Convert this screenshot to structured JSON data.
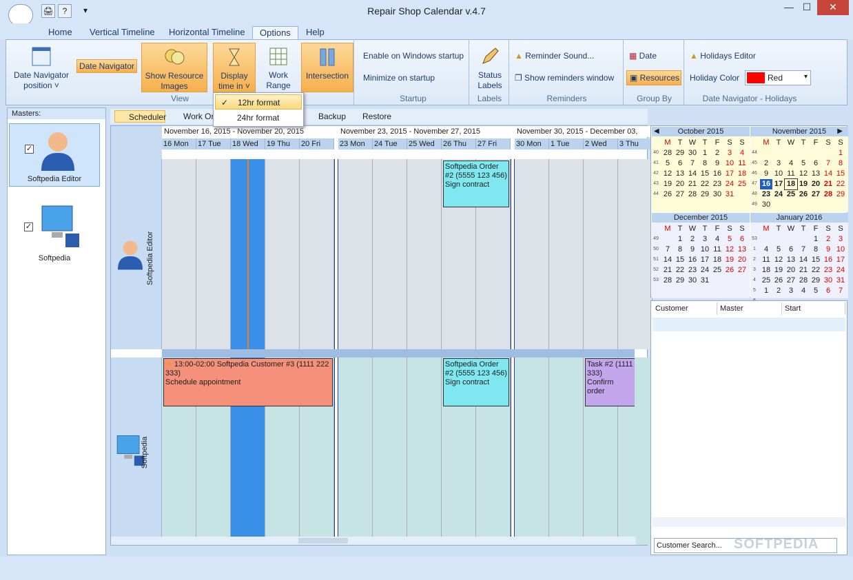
{
  "window": {
    "title": "Repair Shop Calendar v.4.7",
    "min": "—",
    "max": "☐",
    "close": "✕"
  },
  "quick": {
    "print": "🖨",
    "help": "?",
    "more": "▾"
  },
  "tabs": [
    "Home",
    "Vertical Timeline",
    "Horizontal Timeline",
    "Options",
    "Help"
  ],
  "ribbon": {
    "view": {
      "label": "View",
      "datenav_pos": "Date Navigator position ˅",
      "datenav": "Date Navigator",
      "show_res": "Show Resource Images",
      "display_time": "Display time in ˅",
      "work_range": "Work Range",
      "intersection": "Intersection"
    },
    "startup": {
      "label": "Startup",
      "enable": "Enable on Windows startup",
      "minimize": "Minimize on startup"
    },
    "labels": {
      "label": "Labels",
      "status": "Status Labels"
    },
    "reminders": {
      "label": "Reminders",
      "sound": "Reminder Sound...",
      "show": "Show reminders window"
    },
    "groupby": {
      "label": "Group By",
      "date": "Date",
      "resources": "Resources"
    },
    "holidays": {
      "label": "Date Navigator - Holidays",
      "editor": "Holidays Editor",
      "color_label": "Holiday Color",
      "color_value": "Red"
    }
  },
  "dropdown": {
    "opt1": "12hr format",
    "opt2": "24hr format",
    "check": "✓"
  },
  "masters": {
    "header": "Masters:",
    "items": [
      "Softpedia Editor",
      "Softpedia"
    ]
  },
  "toolbar2": {
    "scheduler": "Scheduler",
    "workorders": "Work Or",
    "backup": "Backup",
    "restore": "Restore"
  },
  "schedule": {
    "weeks": [
      "November 16, 2015 - November 20, 2015",
      "November 23, 2015 - November 27, 2015",
      "November 30, 2015 - December 03,"
    ],
    "days": [
      "16 Mon",
      "17 Tue",
      "18 Wed",
      "19 Thu",
      "20 Fri",
      "23 Mon",
      "24 Tue",
      "25 Wed",
      "26 Thu",
      "27 Fri",
      "30 Mon",
      "1 Tue",
      "2 Wed",
      "3 Thu"
    ],
    "resources": [
      "Softpedia Editor",
      "Softpedia"
    ],
    "events": [
      {
        "title": "Softpedia Order #2 (5555 123 456)",
        "desc": "Sign contract"
      },
      {
        "title": "13:00-02:00 Softpedia Customer #3 (1111 222 333)",
        "desc": "Schedule appointment"
      },
      {
        "title": "Softpedia Order #2 (5555 123 456)",
        "desc": "Sign contract"
      },
      {
        "title": "Task #2 (1111 333)",
        "desc": "Confirm order"
      }
    ]
  },
  "calendar": {
    "months": [
      {
        "name": "October 2015",
        "wk": [
          "40",
          "41",
          "42",
          "43",
          "44"
        ],
        "rows": [
          [
            "28",
            "29",
            "30",
            "1",
            "2",
            "3",
            "4"
          ],
          [
            "5",
            "6",
            "7",
            "8",
            "9",
            "10",
            "11"
          ],
          [
            "12",
            "13",
            "14",
            "15",
            "16",
            "17",
            "18"
          ],
          [
            "19",
            "20",
            "21",
            "22",
            "23",
            "24",
            "25"
          ],
          [
            "26",
            "27",
            "28",
            "29",
            "30",
            "31",
            ""
          ]
        ]
      },
      {
        "name": "November 2015",
        "wk": [
          "44",
          "45",
          "46",
          "47",
          "48",
          "49"
        ],
        "rows": [
          [
            "",
            "",
            "",
            "",
            "",
            "",
            "1"
          ],
          [
            "2",
            "3",
            "4",
            "5",
            "6",
            "7",
            "8"
          ],
          [
            "9",
            "10",
            "11",
            "12",
            "13",
            "14",
            "15"
          ],
          [
            "16",
            "17",
            "18",
            "19",
            "20",
            "21",
            "22"
          ],
          [
            "23",
            "24",
            "25",
            "26",
            "27",
            "28",
            "29"
          ],
          [
            "30",
            "",
            "",
            "",
            "",
            "",
            ""
          ]
        ]
      },
      {
        "name": "December 2015",
        "wk": [
          "49",
          "50",
          "51",
          "52",
          "53"
        ],
        "rows": [
          [
            "",
            "1",
            "2",
            "3",
            "4",
            "5",
            "6"
          ],
          [
            "7",
            "8",
            "9",
            "10",
            "11",
            "12",
            "13"
          ],
          [
            "14",
            "15",
            "16",
            "17",
            "18",
            "19",
            "20"
          ],
          [
            "21",
            "22",
            "23",
            "24",
            "25",
            "26",
            "27"
          ],
          [
            "28",
            "29",
            "30",
            "31",
            "",
            "",
            ""
          ]
        ]
      },
      {
        "name": "January 2016",
        "wk": [
          "53",
          "1",
          "2",
          "3",
          "4",
          "5",
          "6"
        ],
        "rows": [
          [
            "",
            "",
            "",
            "",
            "1",
            "2",
            "3"
          ],
          [
            "4",
            "5",
            "6",
            "7",
            "8",
            "9",
            "10"
          ],
          [
            "11",
            "12",
            "13",
            "14",
            "15",
            "16",
            "17"
          ],
          [
            "18",
            "19",
            "20",
            "21",
            "22",
            "23",
            "24"
          ],
          [
            "25",
            "26",
            "27",
            "28",
            "29",
            "30",
            "31"
          ],
          [
            "1",
            "2",
            "3",
            "4",
            "5",
            "6",
            "7"
          ]
        ]
      }
    ],
    "dow": [
      "M",
      "T",
      "W",
      "T",
      "F",
      "S",
      "S"
    ],
    "nav_prev": "◀",
    "nav_next": "▶"
  },
  "list": {
    "columns": [
      "Customer",
      "Master",
      "Start"
    ],
    "search": "Customer Search...",
    "watermark": "SOFTPEDIA"
  },
  "colors": {
    "accent": "#f6b04c",
    "event_cyan": "#7fe7ef",
    "event_red": "#f5907a",
    "event_purple": "#c3a6ec",
    "holiday": "#ff0000"
  }
}
